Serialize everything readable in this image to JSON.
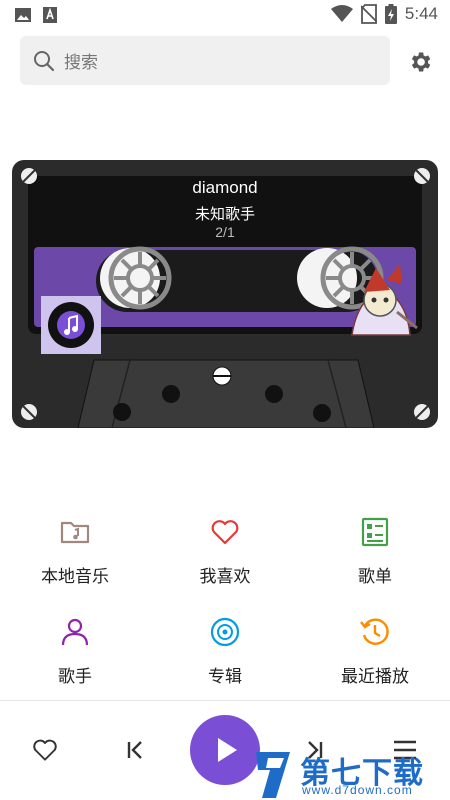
{
  "status_bar": {
    "time": "5:44",
    "left_icons": [
      "image-icon",
      "font-icon"
    ],
    "right_icons": [
      "wifi-icon",
      "no-sim-icon",
      "battery-charging-icon"
    ]
  },
  "search": {
    "placeholder": "搜索"
  },
  "now_playing": {
    "title": "diamond",
    "artist": "未知歌手",
    "index": "2/1"
  },
  "menu": [
    {
      "label": "本地音乐",
      "icon": "folder-music-icon",
      "color": "#a1887f"
    },
    {
      "label": "我喜欢",
      "icon": "heart-icon",
      "color": "#e53935"
    },
    {
      "label": "歌单",
      "icon": "playlist-icon",
      "color": "#43a047"
    },
    {
      "label": "歌手",
      "icon": "person-icon",
      "color": "#8e24aa"
    },
    {
      "label": "专辑",
      "icon": "disc-icon",
      "color": "#039be5"
    },
    {
      "label": "最近播放",
      "icon": "history-icon",
      "color": "#fb8c00"
    }
  ],
  "colors": {
    "accent": "#7a4fd6",
    "cassette_body": "#2b2b2b",
    "cassette_label": "#6c49a8"
  },
  "watermark": {
    "text": "第七下载站",
    "url": "www.d7down.com"
  }
}
